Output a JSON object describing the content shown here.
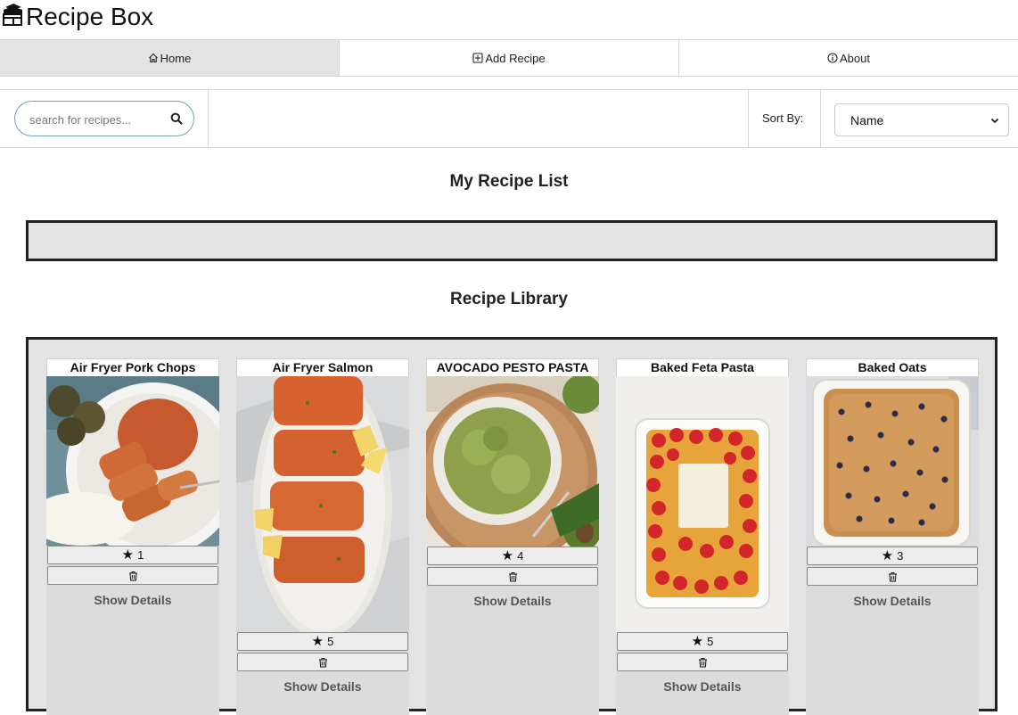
{
  "app": {
    "title": "Recipe Box"
  },
  "nav": {
    "tabs": [
      {
        "label": "Home",
        "icon": "home-icon",
        "active": true
      },
      {
        "label": "Add Recipe",
        "icon": "plus-square-icon",
        "active": false
      },
      {
        "label": "About",
        "icon": "info-circle-icon",
        "active": false
      }
    ]
  },
  "toolbar": {
    "search_placeholder": "search for recipes...",
    "sort_label": "Sort By:",
    "sort_value": "Name"
  },
  "sections": {
    "my_list_title": "My Recipe List",
    "library_title": "Recipe Library"
  },
  "recipes": [
    {
      "title": "Air Fryer Pork Chops",
      "rating": "1",
      "details_label": "Show Details"
    },
    {
      "title": "Air Fryer Salmon",
      "rating": "5",
      "details_label": "Show Details"
    },
    {
      "title": "AVOCADO PESTO PASTA",
      "rating": "4",
      "details_label": "Show Details"
    },
    {
      "title": "Baked Feta Pasta",
      "rating": "5",
      "details_label": "Show Details"
    },
    {
      "title": "Baked Oats",
      "rating": "3",
      "details_label": "Show Details"
    }
  ],
  "colors": {
    "accent_border": "#6fa3b5",
    "panel_bg": "#e3e3e3",
    "box_border": "#222222"
  }
}
